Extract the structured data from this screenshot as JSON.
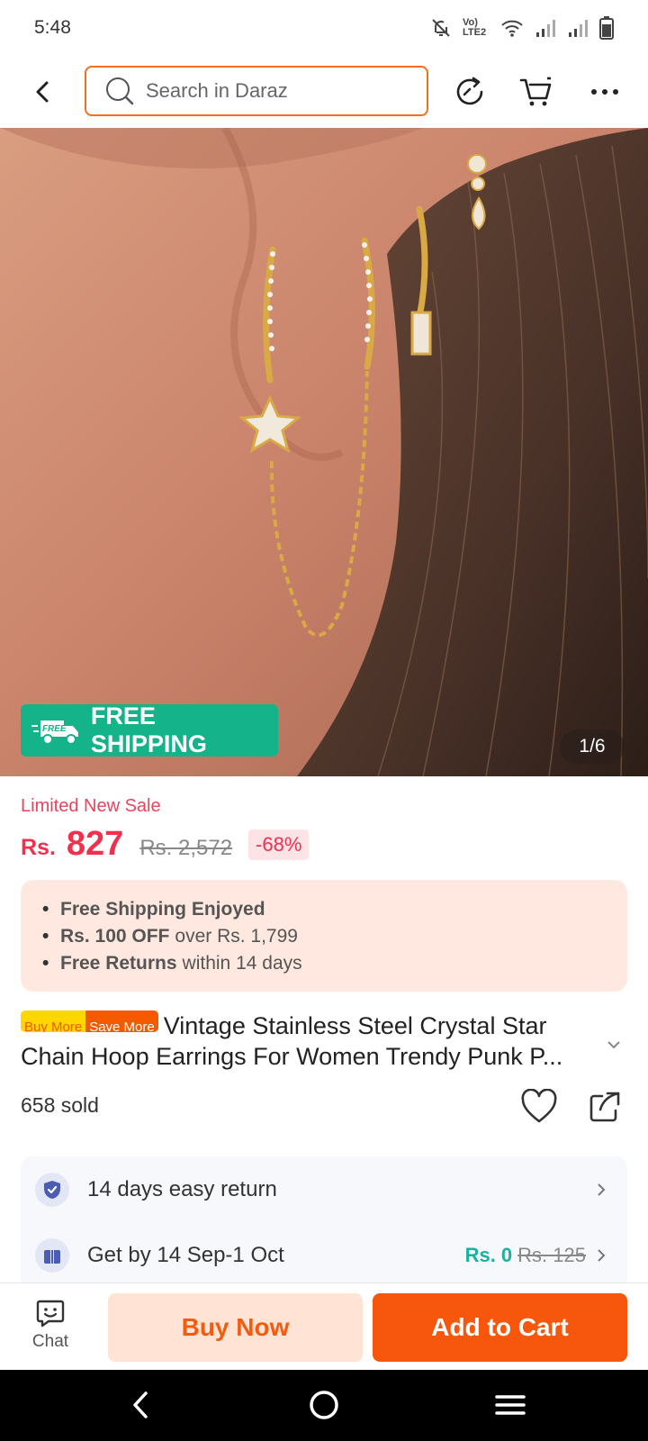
{
  "status_bar": {
    "time": "5:48",
    "network_label": "Vo) LTE2"
  },
  "header": {
    "search_placeholder": "Search in Daraz"
  },
  "gallery": {
    "badge_free_label": "FREE",
    "free_shipping_label": "FREE SHIPPING",
    "counter": "1/6"
  },
  "price": {
    "promo_label": "Limited New Sale",
    "currency": "Rs.",
    "current": "827",
    "original": "Rs. 2,572",
    "discount": "-68%"
  },
  "benefits": [
    {
      "bold": "Free Shipping Enjoyed",
      "rest": ""
    },
    {
      "bold": "Rs. 100 OFF",
      "rest": "over Rs. 1,799"
    },
    {
      "bold": "Free Returns",
      "rest": "within 14 days"
    }
  ],
  "product": {
    "tag_buy_more": "Buy More",
    "tag_save_more": "Save More",
    "title": "Vintage Stainless Steel Crystal Star Chain Hoop Earrings For Women Trendy Punk P...",
    "sold": "658 sold"
  },
  "services": {
    "return_label": "14 days easy return",
    "delivery_label": "Get by 14 Sep-1 Oct",
    "delivery_price": "Rs. 0",
    "delivery_old_price": "Rs. 125"
  },
  "actions": {
    "chat_label": "Chat",
    "buy_now_label": "Buy Now",
    "add_to_cart_label": "Add to Cart"
  },
  "colors": {
    "accent": "#f6570d",
    "price": "#f1304e",
    "free_shipping": "#15b38a",
    "benefit_bg": "#ffe8df"
  }
}
